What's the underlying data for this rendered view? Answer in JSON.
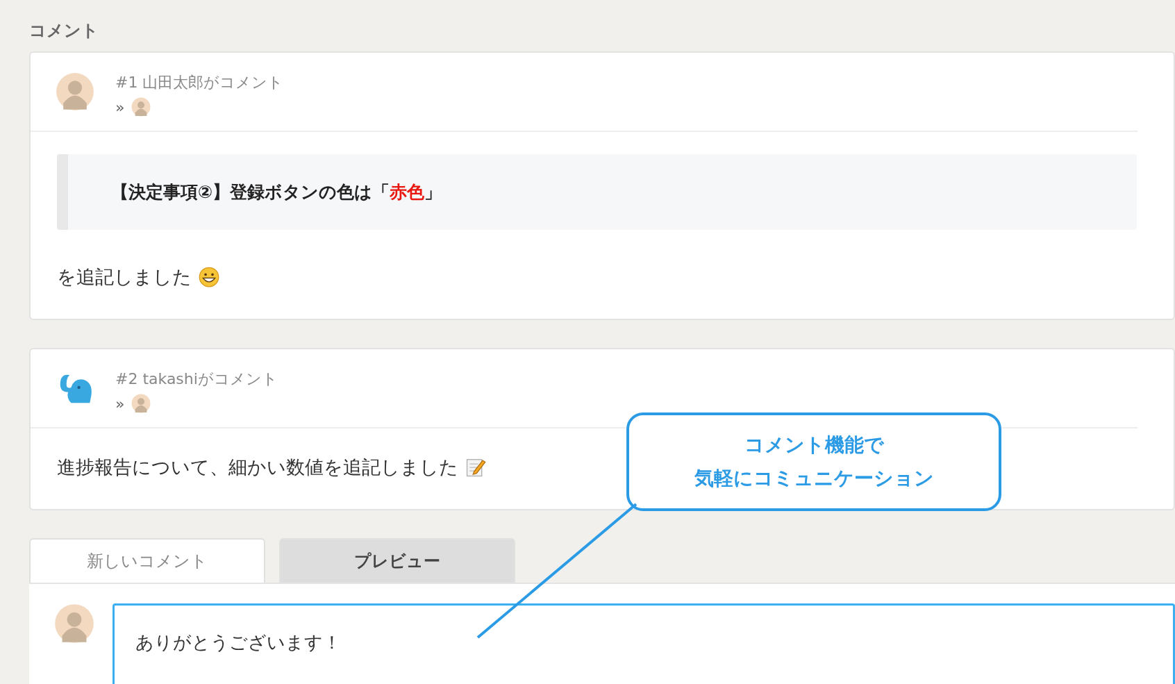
{
  "section_title": "コメント",
  "comments": [
    {
      "kind": "person",
      "title": "#1 山田太郎がコメント",
      "reply_marker": "»",
      "body": [
        {
          "kind": "quote",
          "parts": [
            {
              "text": "【決定事項②】登録ボタンの色は「",
              "highlight": false
            },
            {
              "text": "赤色",
              "highlight": true
            },
            {
              "text": "」",
              "highlight": false
            }
          ]
        },
        {
          "kind": "smiley",
          "text": "を追記しました"
        }
      ]
    },
    {
      "kind": "elephant",
      "title": "#2 takashiがコメント",
      "reply_marker": "»",
      "body": [
        {
          "kind": "memo",
          "text": "進捗報告について、細かい数値を追記しました"
        }
      ]
    }
  ],
  "composer": {
    "tabs": [
      {
        "label": "新しいコメント",
        "selected": true
      },
      {
        "label": "プレビュー",
        "selected": false
      }
    ],
    "value": "ありがとうございます！"
  },
  "callout": {
    "lines": [
      "コメント機能で",
      "気軽にコミュニケーション"
    ]
  }
}
